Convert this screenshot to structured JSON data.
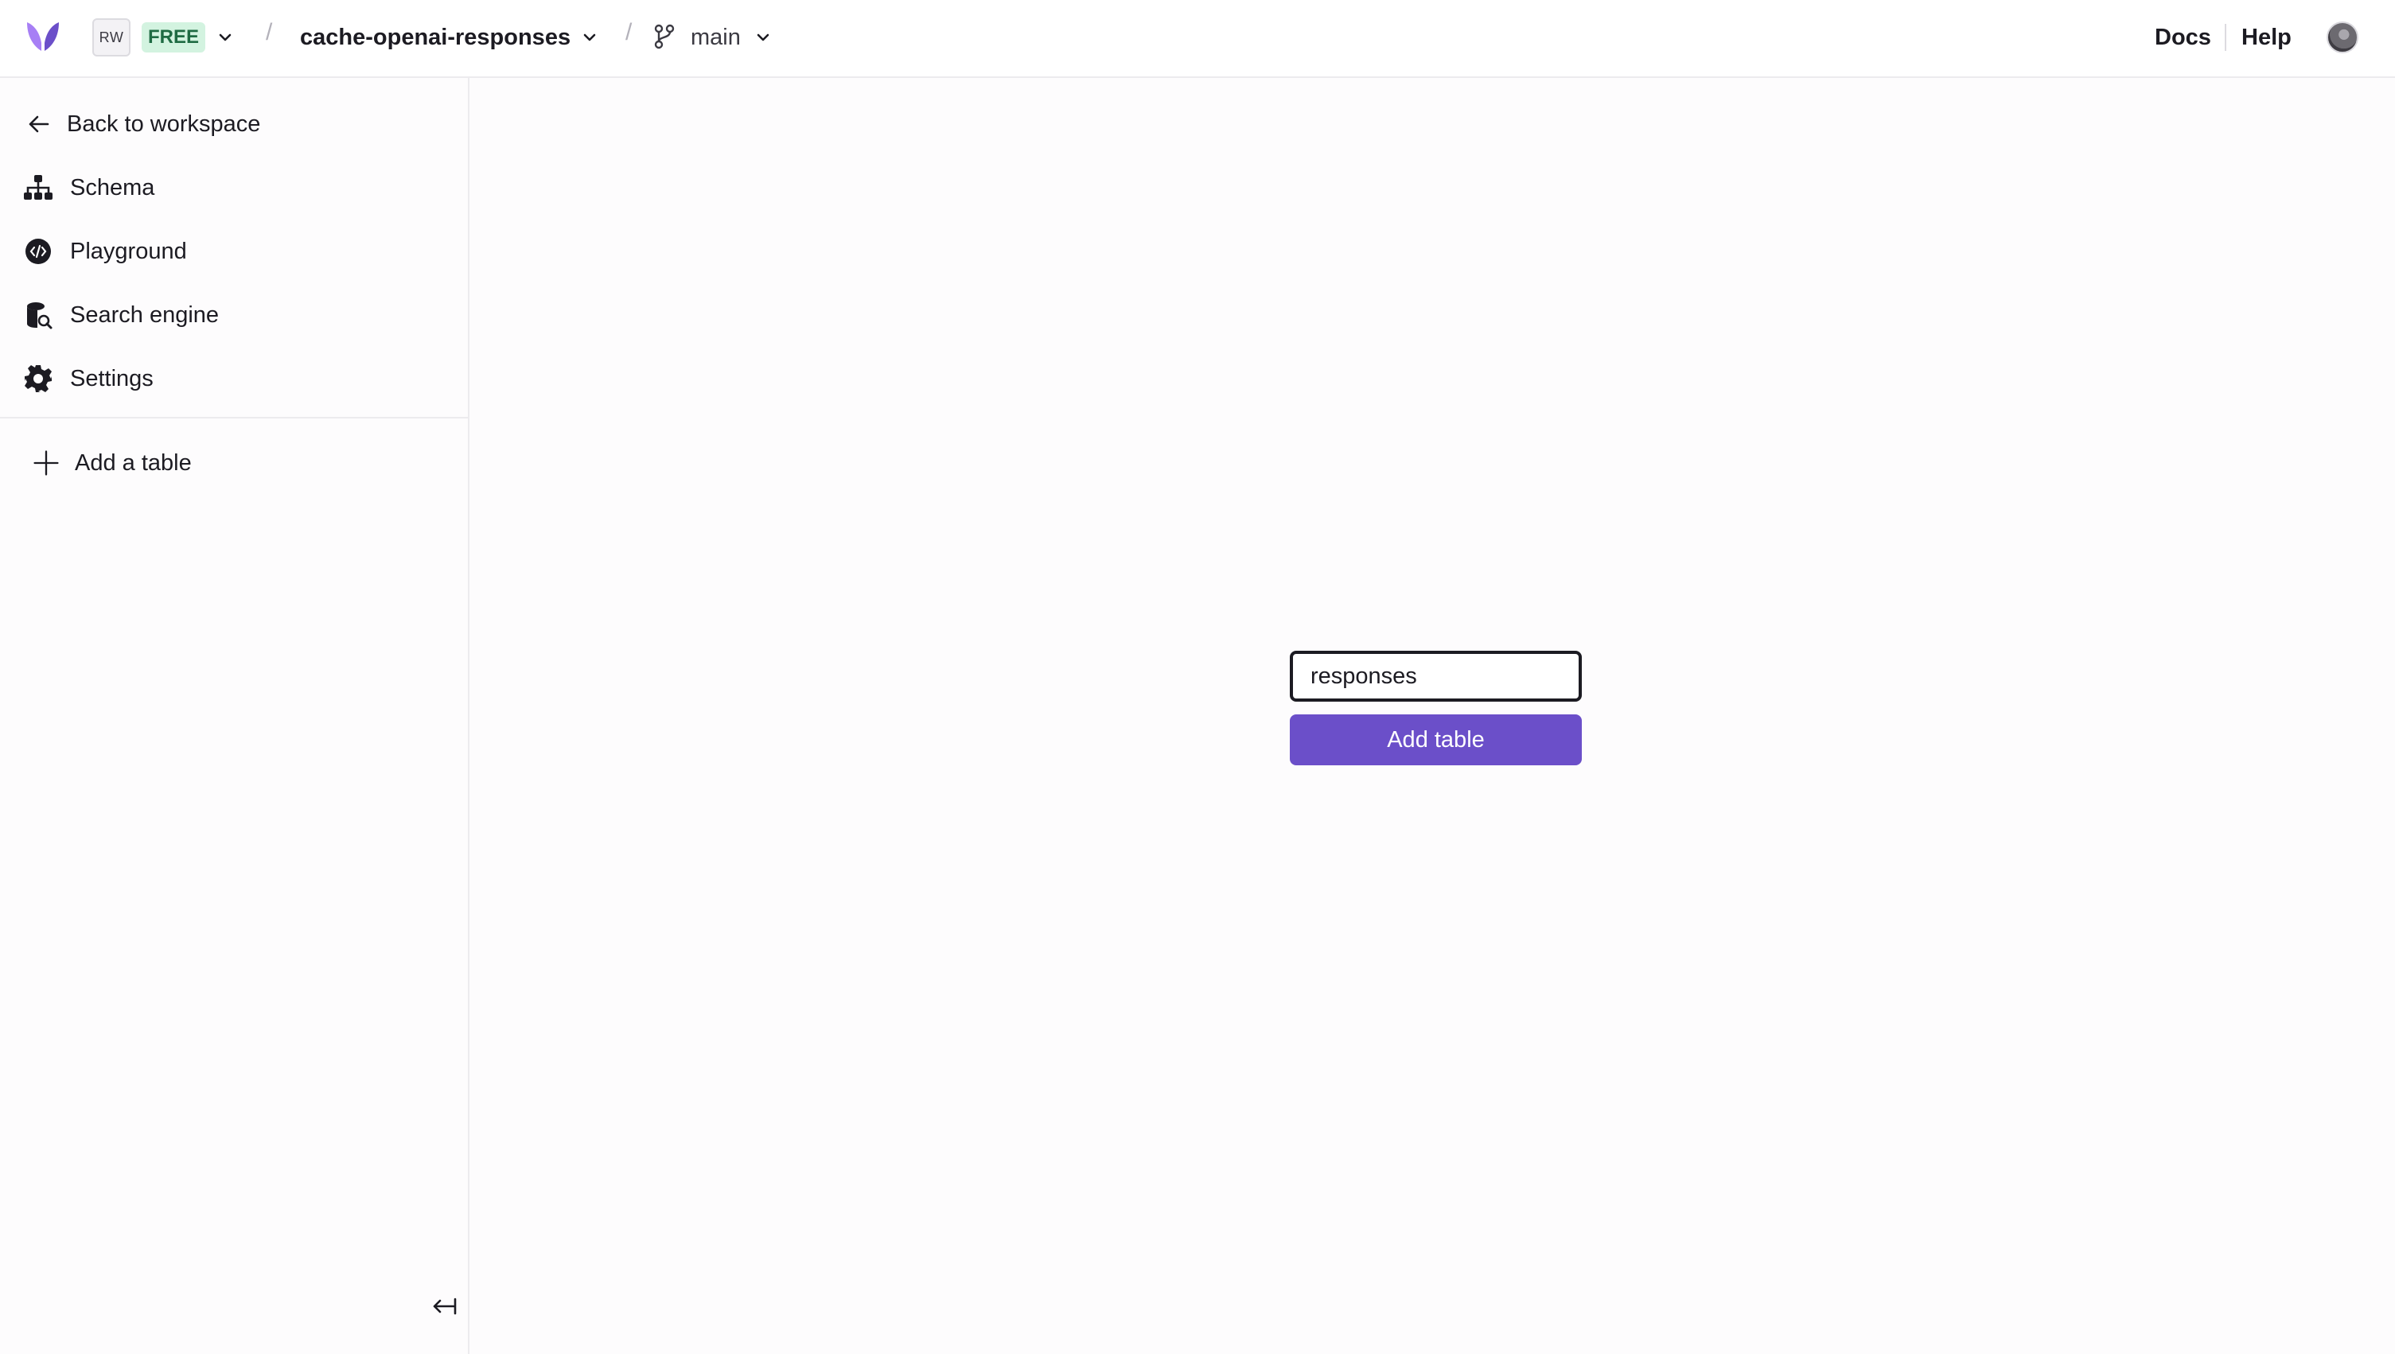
{
  "header": {
    "workspace_initials": "RW",
    "plan_badge": "FREE",
    "database_name": "cache-openai-responses",
    "branch_name": "main",
    "docs_label": "Docs",
    "help_label": "Help",
    "breadcrumb_separator": "/"
  },
  "sidebar": {
    "back_label": "Back to workspace",
    "items": [
      {
        "label": "Schema",
        "icon": "schema-icon"
      },
      {
        "label": "Playground",
        "icon": "playground-icon"
      },
      {
        "label": "Search engine",
        "icon": "search-engine-icon"
      },
      {
        "label": "Settings",
        "icon": "gear-icon"
      }
    ],
    "add_table_label": "Add a table"
  },
  "main": {
    "table_name_value": "responses",
    "add_table_button": "Add table"
  },
  "colors": {
    "accent": "#6b4fc9",
    "badge_bg": "#d3f3e0",
    "badge_text": "#1f6b43"
  }
}
